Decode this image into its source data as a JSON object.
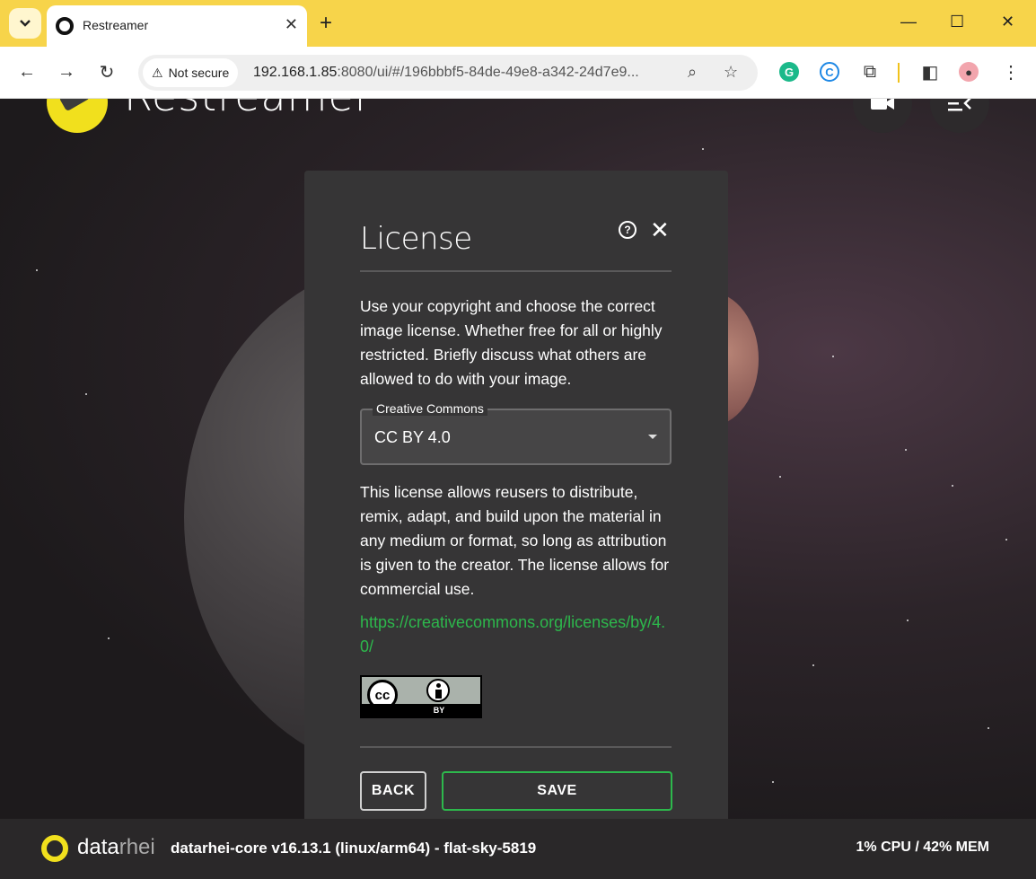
{
  "browser": {
    "tab_title": "Restreamer",
    "security_label": "Not secure",
    "url_host": "192.168.1.85",
    "url_rest": ":8080/ui/#/196bbbf5-84de-49e8-a342-24d7e9..."
  },
  "app": {
    "brand": "Restreamer"
  },
  "dialog": {
    "title": "License",
    "intro": "Use your copyright and choose the correct image license. Whether free for all or highly restricted. Briefly discuss what others are allowed to do with your image.",
    "select_label": "Creative Commons",
    "select_value": "CC BY 4.0",
    "description": "This license allows reusers to distribute, remix, adapt, and build upon the material in any medium or format, so long as attribution is given to the creator. The license allows for commercial use.",
    "link": "https://creativecommons.org/licenses/by/4.0/",
    "badge": {
      "cc": "cc",
      "by": "BY"
    },
    "back_label": "BACK",
    "save_label": "SAVE"
  },
  "footer": {
    "logo_a": "data",
    "logo_b": "rhei",
    "core_info": "datarhei-core v16.13.1 (linux/arm64) - flat-sky-5819",
    "stats": "1% CPU / 42% MEM"
  },
  "colors": {
    "tab_bar": "#f7d44a",
    "accent_green": "#2db84c",
    "brand_yellow": "#f1e01d",
    "dialog_bg": "#363536"
  }
}
